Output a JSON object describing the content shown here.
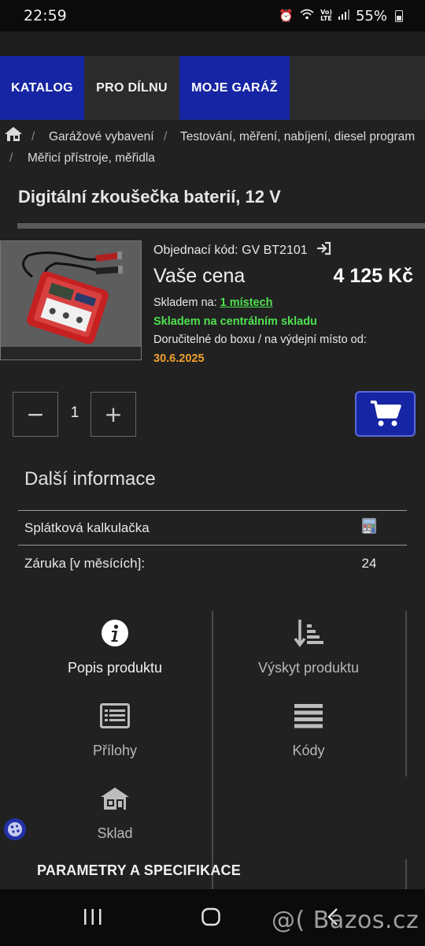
{
  "status_bar": {
    "time": "22:59",
    "battery": "55%"
  },
  "nav": {
    "tabs": [
      "KATALOG",
      "PRO DÍLNU",
      "MOJE GARÁŽ"
    ]
  },
  "breadcrumb": {
    "items": [
      "Garážové vybavení",
      "Testování, měření, nabíjení, diesel program",
      "Měřicí přístroje, měřidla"
    ],
    "separator": "/"
  },
  "product": {
    "title": "Digitální zkoušečka baterií, 12 V",
    "order_code": "Objednací kód: GV BT2101",
    "price_label": "Vaše cena",
    "price_value": "4 125 Kč",
    "stock_prefix": "Skladem na:",
    "stock_link": "1 místech",
    "stock_central": "Skladem na centrálním skladu",
    "delivery_text": "Doručitelné do boxu / na výdejní místo od:",
    "delivery_date": "30.6.2025",
    "quantity": "1",
    "minus": "−",
    "plus": "+"
  },
  "more_info": {
    "title": "Další informace",
    "rows": [
      {
        "label": "Splátková kalkulačka",
        "value": ""
      },
      {
        "label": "Záruka [v měsících]:",
        "value": "24"
      }
    ]
  },
  "tiles": [
    {
      "label": "Popis produktu",
      "icon": "info-icon"
    },
    {
      "label": "Výskyt produktu",
      "icon": "sort-icon"
    },
    {
      "label": "Přílohy",
      "icon": "list-box-icon"
    },
    {
      "label": "Kódy",
      "icon": "lines-icon"
    },
    {
      "label": "Sklad",
      "icon": "warehouse-icon"
    }
  ],
  "params_title": "PARAMETRY A SPECIFIKACE",
  "watermark": "@( Bazos.cz",
  "colors": {
    "brand_blue": "#1625a3",
    "stock_green": "#4fe04f",
    "date_orange": "#f0a030"
  }
}
